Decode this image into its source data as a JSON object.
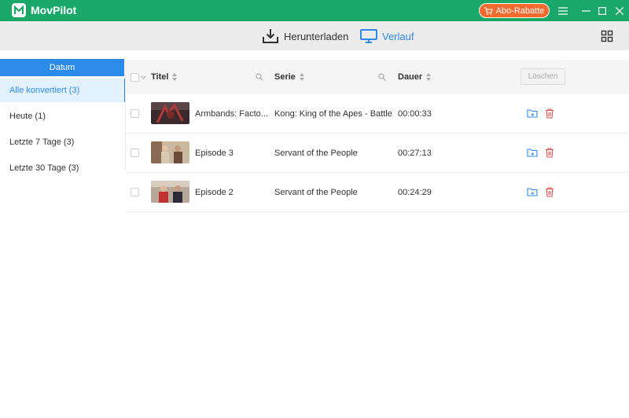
{
  "app": {
    "title": "MovPilot",
    "promo_label": "Abo-Rabatte"
  },
  "nav": {
    "download_label": "Herunterladen",
    "history_label": "Verlauf"
  },
  "sidebar": {
    "header": "Datum",
    "items": [
      {
        "label": "Alle konvertiert (3)",
        "active": true
      },
      {
        "label": "Heute (1)",
        "active": false
      },
      {
        "label": "Letzte 7 Tage (3)",
        "active": false
      },
      {
        "label": "Letzte 30 Tage (3)",
        "active": false
      }
    ]
  },
  "table": {
    "columns": {
      "title": "Titel",
      "series": "Serie",
      "duration": "Dauer"
    },
    "delete_label": "Löschen",
    "rows": [
      {
        "title": "Armbands: Facto...",
        "series": "Kong: King of the Apes - Battles",
        "duration": "00:00:33"
      },
      {
        "title": "Episode 3",
        "series": "Servant of the People",
        "duration": "00:27:13"
      },
      {
        "title": "Episode 2",
        "series": "Servant of the People",
        "duration": "00:24:29"
      }
    ]
  },
  "colors": {
    "brand": "#1aa86a",
    "accent": "#2c8be8",
    "promo": "#f26a2e",
    "danger": "#e05050"
  },
  "icons": [
    "logo-icon",
    "cart-icon",
    "menu-icon",
    "minimize-icon",
    "maximize-icon",
    "close-icon",
    "download-icon",
    "monitor-icon",
    "grid-icon",
    "search-icon",
    "chevron-down-icon",
    "open-folder-icon",
    "trash-icon"
  ]
}
